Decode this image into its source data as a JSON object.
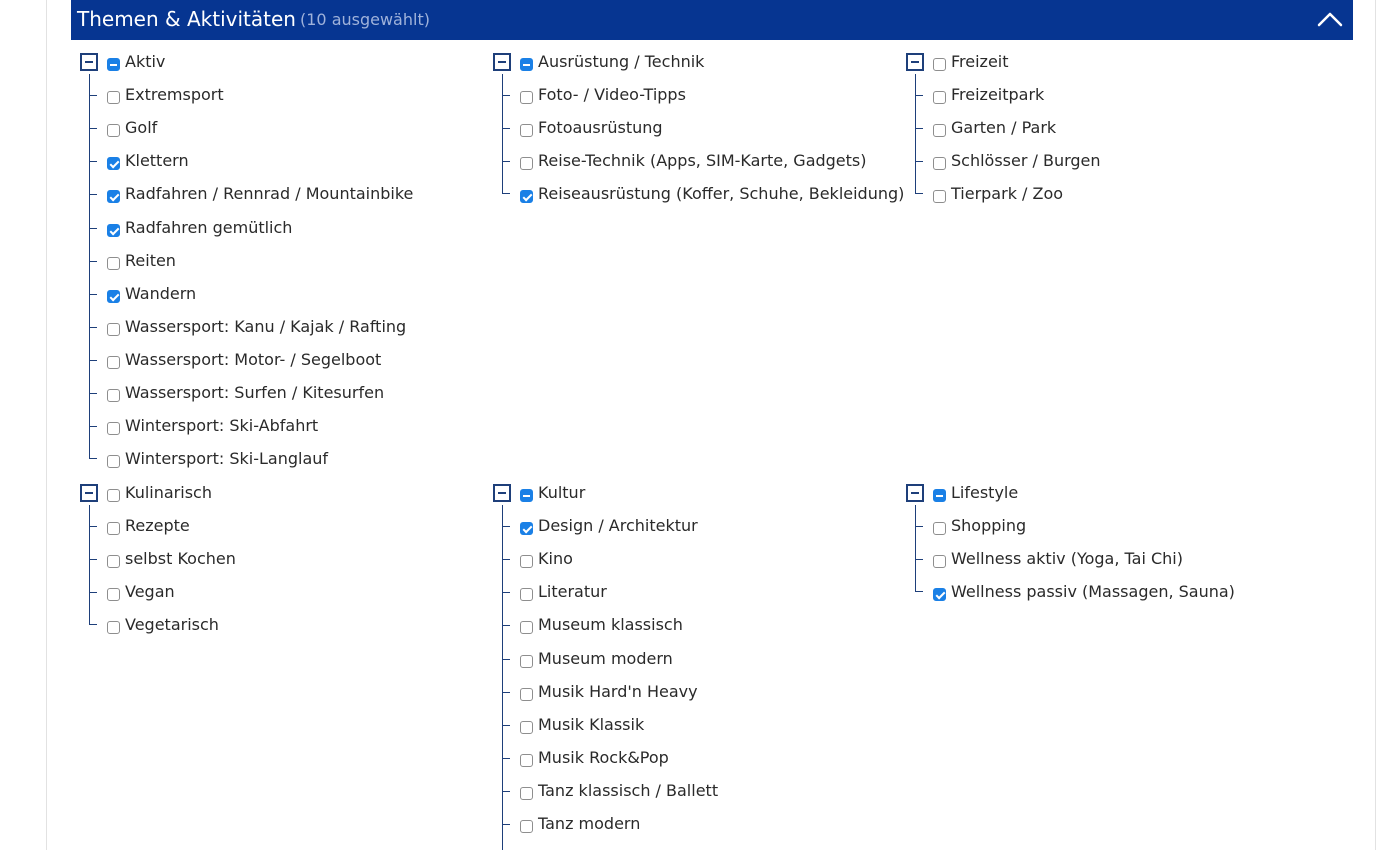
{
  "header": {
    "title": "Themen & Aktivitäten",
    "count": "(10 ausgewählt)",
    "collapse_icon": "chevron-up-icon",
    "background": "#063591"
  },
  "groups": [
    {
      "id": "aktiv",
      "label": "Aktiv",
      "state": "partial",
      "items": [
        {
          "label": "Extremsport",
          "checked": false
        },
        {
          "label": "Golf",
          "checked": false
        },
        {
          "label": "Klettern",
          "checked": true
        },
        {
          "label": "Radfahren / Rennrad / Mountainbike",
          "checked": true
        },
        {
          "label": "Radfahren gemütlich",
          "checked": true
        },
        {
          "label": "Reiten",
          "checked": false
        },
        {
          "label": "Wandern",
          "checked": true
        },
        {
          "label": "Wassersport: Kanu / Kajak / Rafting",
          "checked": false
        },
        {
          "label": "Wassersport: Motor- / Segelboot",
          "checked": false
        },
        {
          "label": "Wassersport: Surfen / Kitesurfen",
          "checked": false
        },
        {
          "label": "Wintersport: Ski-Abfahrt",
          "checked": false
        },
        {
          "label": "Wintersport: Ski-Langlauf",
          "checked": false
        }
      ]
    },
    {
      "id": "ausruestung",
      "label": "Ausrüstung / Technik",
      "state": "partial",
      "items": [
        {
          "label": "Foto- / Video-Tipps",
          "checked": false
        },
        {
          "label": "Fotoausrüstung",
          "checked": false
        },
        {
          "label": "Reise-Technik (Apps, SIM-Karte, Gadgets)",
          "checked": false
        },
        {
          "label": "Reiseausrüstung (Koffer, Schuhe, Bekleidung)",
          "checked": true
        }
      ]
    },
    {
      "id": "freizeit",
      "label": "Freizeit",
      "state": "unchecked",
      "items": [
        {
          "label": "Freizeitpark",
          "checked": false
        },
        {
          "label": "Garten / Park",
          "checked": false
        },
        {
          "label": "Schlösser / Burgen",
          "checked": false
        },
        {
          "label": "Tierpark / Zoo",
          "checked": false
        }
      ]
    },
    {
      "id": "kulinarisch",
      "label": "Kulinarisch",
      "state": "unchecked",
      "items": [
        {
          "label": "Rezepte",
          "checked": false
        },
        {
          "label": "selbst Kochen",
          "checked": false
        },
        {
          "label": "Vegan",
          "checked": false
        },
        {
          "label": "Vegetarisch",
          "checked": false
        }
      ]
    },
    {
      "id": "kultur",
      "label": "Kultur",
      "state": "partial",
      "items": [
        {
          "label": "Design / Architektur",
          "checked": true
        },
        {
          "label": "Kino",
          "checked": false
        },
        {
          "label": "Literatur",
          "checked": false
        },
        {
          "label": "Museum klassisch",
          "checked": false
        },
        {
          "label": "Museum modern",
          "checked": false
        },
        {
          "label": "Musik Hard'n Heavy",
          "checked": false
        },
        {
          "label": "Musik Klassik",
          "checked": false
        },
        {
          "label": "Musik Rock&Pop",
          "checked": false
        },
        {
          "label": "Tanz klassisch / Ballett",
          "checked": false
        },
        {
          "label": "Tanz modern",
          "checked": false
        }
      ]
    },
    {
      "id": "lifestyle",
      "label": "Lifestyle",
      "state": "partial",
      "items": [
        {
          "label": "Shopping",
          "checked": false
        },
        {
          "label": "Wellness aktiv (Yoga, Tai Chi)",
          "checked": false
        },
        {
          "label": "Wellness passiv (Massagen, Sauna)",
          "checked": true
        }
      ]
    }
  ]
}
